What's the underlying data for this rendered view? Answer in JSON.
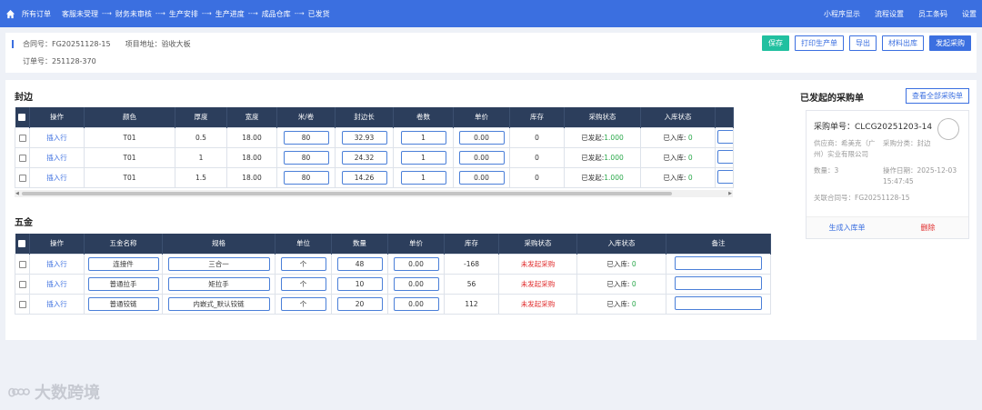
{
  "topbar": {
    "crumbs": [
      "所有订单",
      "客服未受理",
      "财务未审核",
      "生产安排",
      "生产进度",
      "成品仓库",
      "已发货"
    ],
    "right": [
      "小程序显示",
      "流程设置",
      "员工条码",
      "设置"
    ]
  },
  "header": {
    "contract_label": "合同号：FG20251128-15",
    "address_label": "项目地址：验收大板",
    "order_label": "订单号：251128-370",
    "buttons": {
      "save": "保存",
      "print": "打印生产单",
      "export": "导出",
      "material_out": "材料出库",
      "purchase": "发起采购"
    }
  },
  "edge": {
    "title": "封边",
    "columns": [
      "",
      "操作",
      "颜色",
      "厚度",
      "宽度",
      "米/卷",
      "封边长",
      "卷数",
      "单价",
      "库存",
      "采购状态",
      "入库状态",
      ""
    ],
    "rows": [
      {
        "op": "插入行",
        "color": "T01",
        "thick": "0.5",
        "width": "18.00",
        "mroll": "80",
        "len": "32.93",
        "rolls": "1",
        "price": "0.00",
        "stock": "0",
        "pstatus_label": "已发起:",
        "pstatus_val": "1.000",
        "in_label": "已入库:",
        "in_val": "0"
      },
      {
        "op": "插入行",
        "color": "T01",
        "thick": "1",
        "width": "18.00",
        "mroll": "80",
        "len": "24.32",
        "rolls": "1",
        "price": "0.00",
        "stock": "0",
        "pstatus_label": "已发起:",
        "pstatus_val": "1.000",
        "in_label": "已入库:",
        "in_val": "0"
      },
      {
        "op": "插入行",
        "color": "T01",
        "thick": "1.5",
        "width": "18.00",
        "mroll": "80",
        "len": "14.26",
        "rolls": "1",
        "price": "0.00",
        "stock": "0",
        "pstatus_label": "已发起:",
        "pstatus_val": "1.000",
        "in_label": "已入库:",
        "in_val": "0"
      }
    ]
  },
  "hardware": {
    "title": "五金",
    "columns": [
      "",
      "操作",
      "五金名称",
      "规格",
      "单位",
      "数量",
      "单价",
      "库存",
      "采购状态",
      "入库状态",
      "备注"
    ],
    "rows": [
      {
        "op": "插入行",
        "name": "连接件",
        "spec": "三合一",
        "unit": "个",
        "qty": "48",
        "price": "0.00",
        "stock": "-168",
        "pstatus": "未发起采购",
        "in_label": "已入库:",
        "in_val": "0",
        "note": ""
      },
      {
        "op": "插入行",
        "name": "普通拉手",
        "spec": "矩拉手",
        "unit": "个",
        "qty": "10",
        "price": "0.00",
        "stock": "56",
        "pstatus": "未发起采购",
        "in_label": "已入库:",
        "in_val": "0",
        "note": ""
      },
      {
        "op": "插入行",
        "name": "普通铰链",
        "spec": "内嵌式_默认铰链",
        "unit": "个",
        "qty": "20",
        "price": "0.00",
        "stock": "112",
        "pstatus": "未发起采购",
        "in_label": "已入库:",
        "in_val": "0",
        "note": ""
      }
    ]
  },
  "side": {
    "title": "已发起的采购单",
    "view_all": "查看全部采购单",
    "card": {
      "order_no": "采购单号：CLCG20251203-14",
      "supplier": "供应商：希美克（广州）实业有限公司",
      "category": "采购分类：封边",
      "qty": "数量：3",
      "date": "操作日期：2025-12-03 15:47:45",
      "contract": "关联合同号：FG20251128-15",
      "make_in": "生成入库单",
      "delete": "删除"
    }
  },
  "watermark": "大数跨境",
  "colors": {
    "primary": "#3b6fe0",
    "header_row": "#2c3e5c",
    "save": "#21c0a0",
    "ok": "#2aa84a",
    "alert": "#e02a2a"
  }
}
